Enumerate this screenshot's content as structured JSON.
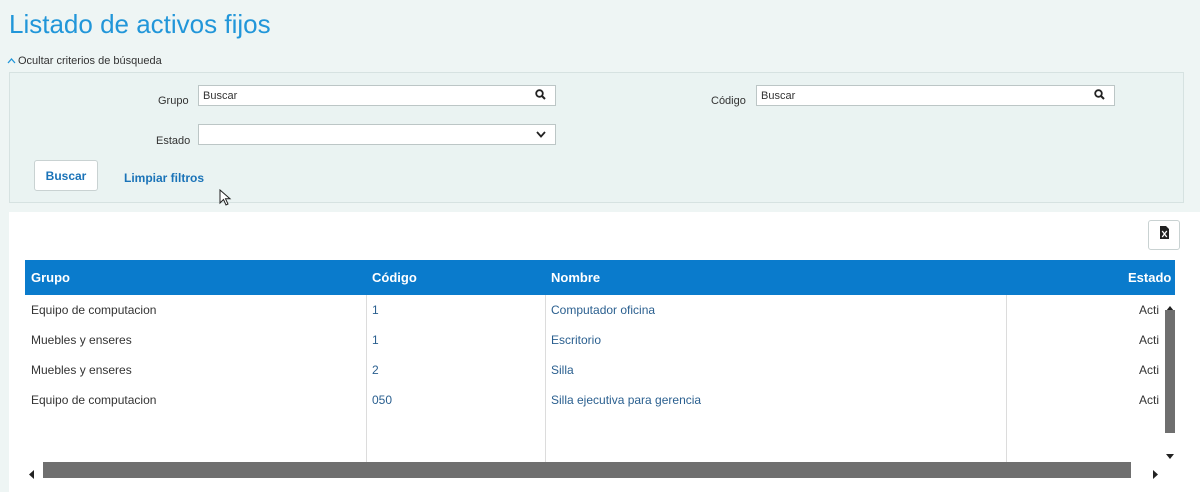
{
  "page": {
    "title": "Listado de activos fijos",
    "toggle_label": "Ocultar criterios de búsqueda"
  },
  "filters": {
    "grupo_label": "Grupo",
    "grupo_placeholder": "Buscar",
    "codigo_label": "Código",
    "codigo_placeholder": "Buscar",
    "estado_label": "Estado",
    "estado_value": "",
    "buscar_button": "Buscar",
    "limpiar_link": "Limpiar filtros"
  },
  "table": {
    "columns": [
      "Grupo",
      "Código",
      "Nombre",
      "Estado"
    ],
    "rows": [
      {
        "grupo": "Equipo de computacion",
        "codigo": "1",
        "nombre": "Computador oficina",
        "estado": "Activ"
      },
      {
        "grupo": "Muebles y enseres",
        "codigo": "1",
        "nombre": "Escritorio",
        "estado": "Activ"
      },
      {
        "grupo": "Muebles y enseres",
        "codigo": "2",
        "nombre": "Silla",
        "estado": "Activ"
      },
      {
        "grupo": "Equipo de computacion",
        "codigo": "050",
        "nombre": "Silla ejecutiva para gerencia",
        "estado": "Activ"
      }
    ]
  },
  "icons": {
    "search": "search-icon",
    "dropdown": "chevron-down-icon",
    "export": "excel-export-icon",
    "toggle": "chevron-up-icon"
  },
  "colors": {
    "accent": "#2196d9",
    "header_bg": "#0a7bcc",
    "link": "#1a73b8"
  }
}
